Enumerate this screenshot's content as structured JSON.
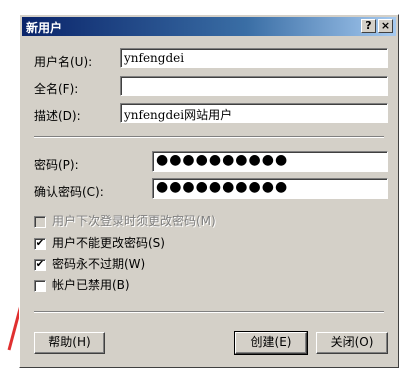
{
  "window": {
    "title": "新用户",
    "help_glyph": "?",
    "close_glyph": "×"
  },
  "fields": {
    "username": {
      "label": "用户名(U):",
      "value": "ynfengdei"
    },
    "fullname": {
      "label": "全名(F):",
      "value": ""
    },
    "description": {
      "label": "描述(D):",
      "value": "ynfengdei网站用户"
    },
    "password": {
      "label": "密码(P):",
      "value": "●●●●●●●●●●"
    },
    "confirm_password": {
      "label": "确认密码(C):",
      "value": "●●●●●●●●●●"
    }
  },
  "options": [
    {
      "label": "用户下次登录时须更改密码(M)",
      "checked": false,
      "disabled": true
    },
    {
      "label": "用户不能更改密码(S)",
      "checked": true,
      "disabled": false
    },
    {
      "label": "密码永不过期(W)",
      "checked": true,
      "disabled": false
    },
    {
      "label": "帐户已禁用(B)",
      "checked": false,
      "disabled": false
    }
  ],
  "check_glyph": "✔",
  "buttons": {
    "help": "帮助(H)",
    "create": "创建(E)",
    "close": "关闭(O)"
  },
  "colors": {
    "dialog": "#d4d0c8",
    "title_start": "#0a246a",
    "arrow": "#e03030"
  }
}
